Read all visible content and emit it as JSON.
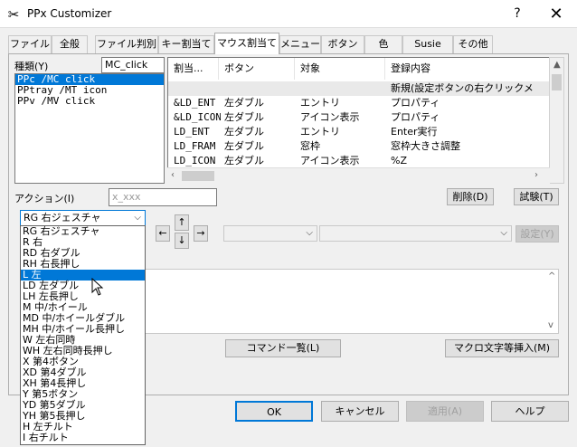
{
  "window": {
    "title": "PPx Customizer",
    "help": "?",
    "close": "✕"
  },
  "tabs": [
    "ファイル",
    "全般",
    "ファイル判別",
    "キー割当て",
    "マウス割当て",
    "メニュー",
    "ボタン",
    "色",
    "Susie",
    "その他"
  ],
  "kind": {
    "label": "種類(Y)",
    "value": "MC_click"
  },
  "type_list": [
    "PPc /MC click",
    "PPtray /MT icon",
    "PPv /MV click"
  ],
  "table": {
    "headers": [
      "割当...",
      "ボタン",
      "対象",
      "登録内容"
    ],
    "new_row": "新規(設定ボタンの右クリックメ",
    "rows": [
      [
        "&LD_ENT",
        "左ダブル",
        "エントリ",
        "プロパティ"
      ],
      [
        "&LD_ICON",
        "左ダブル",
        "アイコン表示",
        "プロパティ"
      ],
      [
        "LD_ENT",
        "左ダブル",
        "エントリ",
        "Enter実行"
      ],
      [
        "LD_FRAM",
        "左ダブル",
        "窓枠",
        "窓枠大きさ調整"
      ],
      [
        "LD_ICON",
        "左ダブル",
        "アイコン表示",
        "%Z"
      ]
    ]
  },
  "action": {
    "label": "アクション(I)",
    "placeholder": "x_xxx",
    "delete": "削除(D)",
    "test": "試験(T)"
  },
  "gesture": {
    "selected": "RG 右ジェスチャ",
    "options": [
      "RG 右ジェスチャ",
      "R 右",
      "RD 右ダブル",
      "RH 右長押し",
      "L 左",
      "LD 左ダブル",
      "LH 左長押し",
      "M 中/ホイール",
      "MD 中/ホイールダブル",
      "MH 中/ホイール長押し",
      "W 左右同時",
      "WH 左右同時長押し",
      "X 第4ボタン",
      "XD 第4ダブル",
      "XH 第4長押し",
      "Y 第5ボタン",
      "YD 第5ダブル",
      "YH 第5長押し",
      "H 左チルト",
      "I 右チルト"
    ],
    "highlighted_index": 4
  },
  "arrows": {
    "up": "↑",
    "down": "↓",
    "left": "←",
    "right": "→"
  },
  "set_button": "設定(Y)",
  "command_list": "コマンド一覧(L)",
  "macro_insert": "マクロ文字等挿入(M)",
  "footer": {
    "ok": "OK",
    "cancel": "キャンセル",
    "apply": "適用(A)",
    "help": "ヘルプ"
  }
}
